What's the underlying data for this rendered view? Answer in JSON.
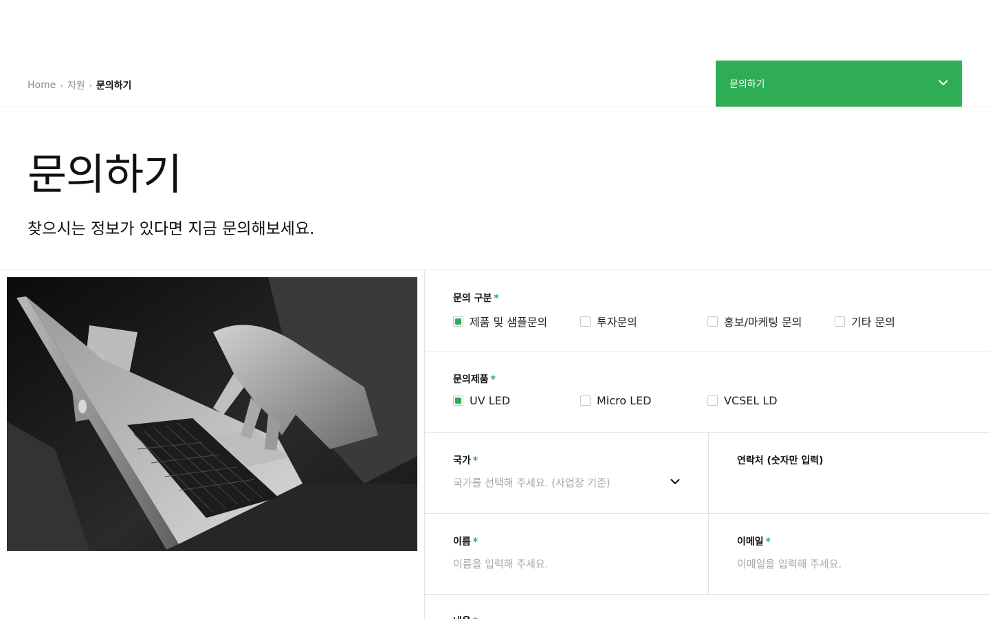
{
  "breadcrumb": {
    "home": "Home",
    "support": "지원",
    "current": "문의하기",
    "separator": "›"
  },
  "nav_select": {
    "label": "문의하기"
  },
  "hero": {
    "title": "문의하기",
    "subtitle": "찾으시는 정보가 있다면 지금 문의해보세요."
  },
  "form": {
    "required_mark": "*",
    "inquiry_type": {
      "label": "문의 구분",
      "options": [
        {
          "label": "제품 및 샘플문의",
          "checked": true
        },
        {
          "label": "투자문의",
          "checked": false
        },
        {
          "label": "홍보/마케팅 문의",
          "checked": false
        },
        {
          "label": "기타 문의",
          "checked": false
        }
      ]
    },
    "product": {
      "label": "문의제품",
      "options": [
        {
          "label": "UV LED",
          "checked": true
        },
        {
          "label": "Micro LED",
          "checked": false
        },
        {
          "label": "VCSEL LD",
          "checked": false
        }
      ]
    },
    "country": {
      "label": "국가",
      "placeholder": "국가를 선택해 주세요. (사업장 기준)"
    },
    "phone": {
      "label": "연락처 (숫자만 입력)"
    },
    "name": {
      "label": "이름",
      "placeholder": "이름을 입력해 주세요."
    },
    "email": {
      "label": "이메일",
      "placeholder": "이메일을 입력해 주세요."
    },
    "content": {
      "label": "내용"
    }
  },
  "colors": {
    "accent": "#2fad55",
    "border": "#e4e4e4",
    "placeholder": "#a8a8a8"
  },
  "icons": {
    "nav_chevron": "chevron-down-icon",
    "country_chevron": "chevron-down-icon",
    "breadcrumb_separator": "chevron-right-icon"
  }
}
